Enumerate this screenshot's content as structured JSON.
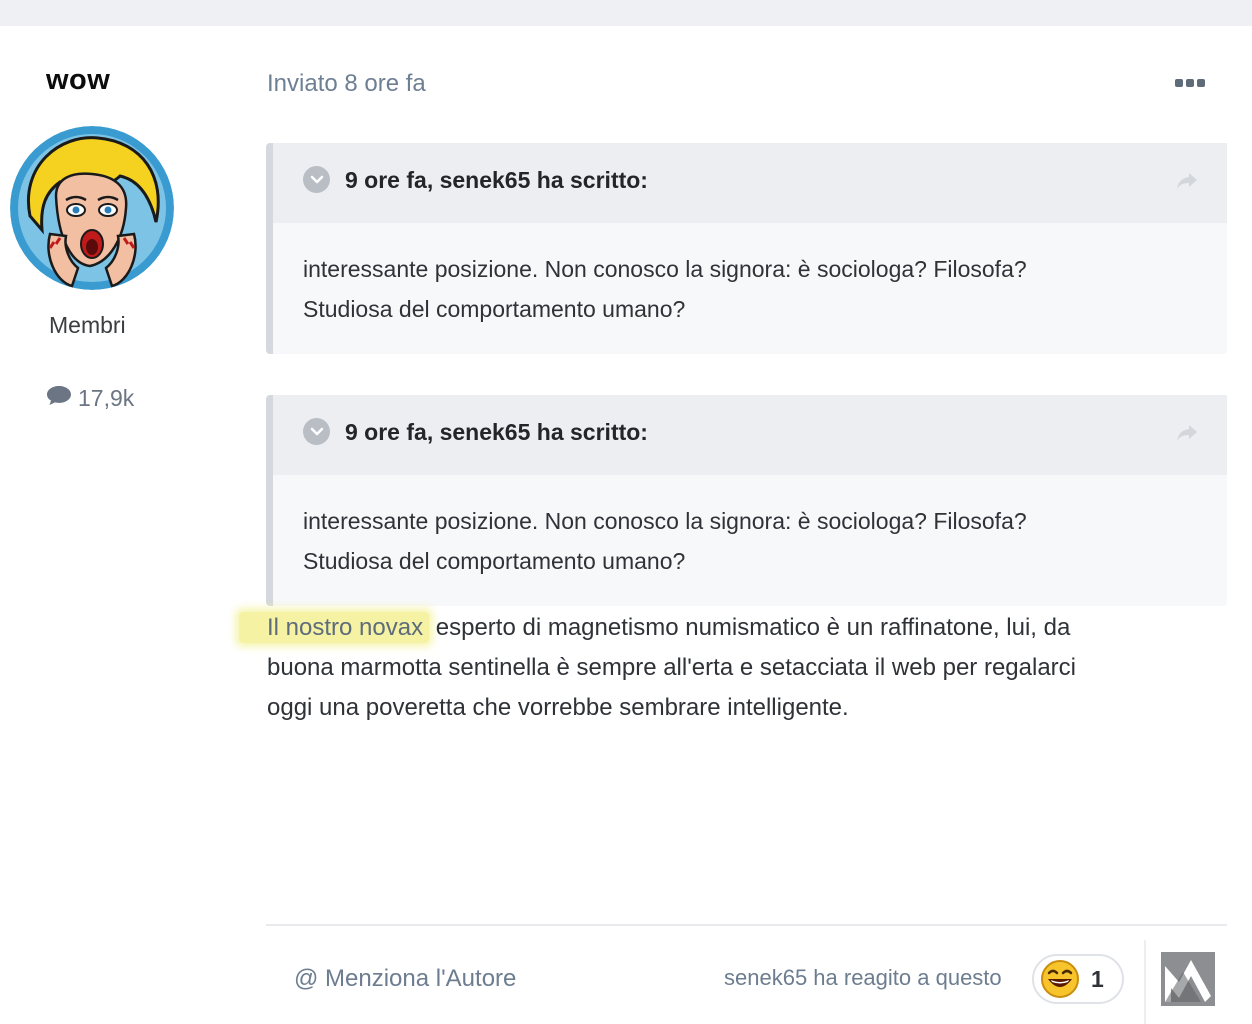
{
  "author": {
    "name": "wow",
    "group": "Membri",
    "post_count": "17,9k"
  },
  "post": {
    "date": "Inviato 8 ore fa",
    "quotes": [
      {
        "citation": "9 ore fa, senek65 ha scritto:",
        "line1": "interessante posizione.  Non conosco la signora: è sociologa? Filosofa?",
        "line2": "Studiosa del comportamento umano?"
      },
      {
        "citation": "9 ore fa, senek65 ha scritto:",
        "line1": "interessante posizione.  Non conosco la signora: è sociologa? Filosofa?",
        "line2": "Studiosa del comportamento umano?"
      }
    ],
    "body_highlight": "Il nostro novax",
    "body_line1_rest": " esperto di magnetismo numismatico è un raffinatone, lui, da",
    "body_line2": "buona marmotta sentinella è sempre all'erta e setacciata il web per regalarci",
    "body_line3": "oggi una poveretta che vorrebbe sembrare intelligente."
  },
  "footer": {
    "mention": "@ Menziona l'Autore",
    "reacted": "senek65 ha reagito a questo",
    "reaction_count": "1"
  },
  "icons": {
    "more": "more-dots-icon",
    "toggle": "chevron-down-icon",
    "share": "share-arrow-icon",
    "posts": "speech-bubble-icon",
    "reaction": "laughing-emoji-icon"
  },
  "colors": {
    "highlight": "#f5f3a3",
    "muted_text": "#6e7f93",
    "quote_bg": "#f7f8fa"
  }
}
